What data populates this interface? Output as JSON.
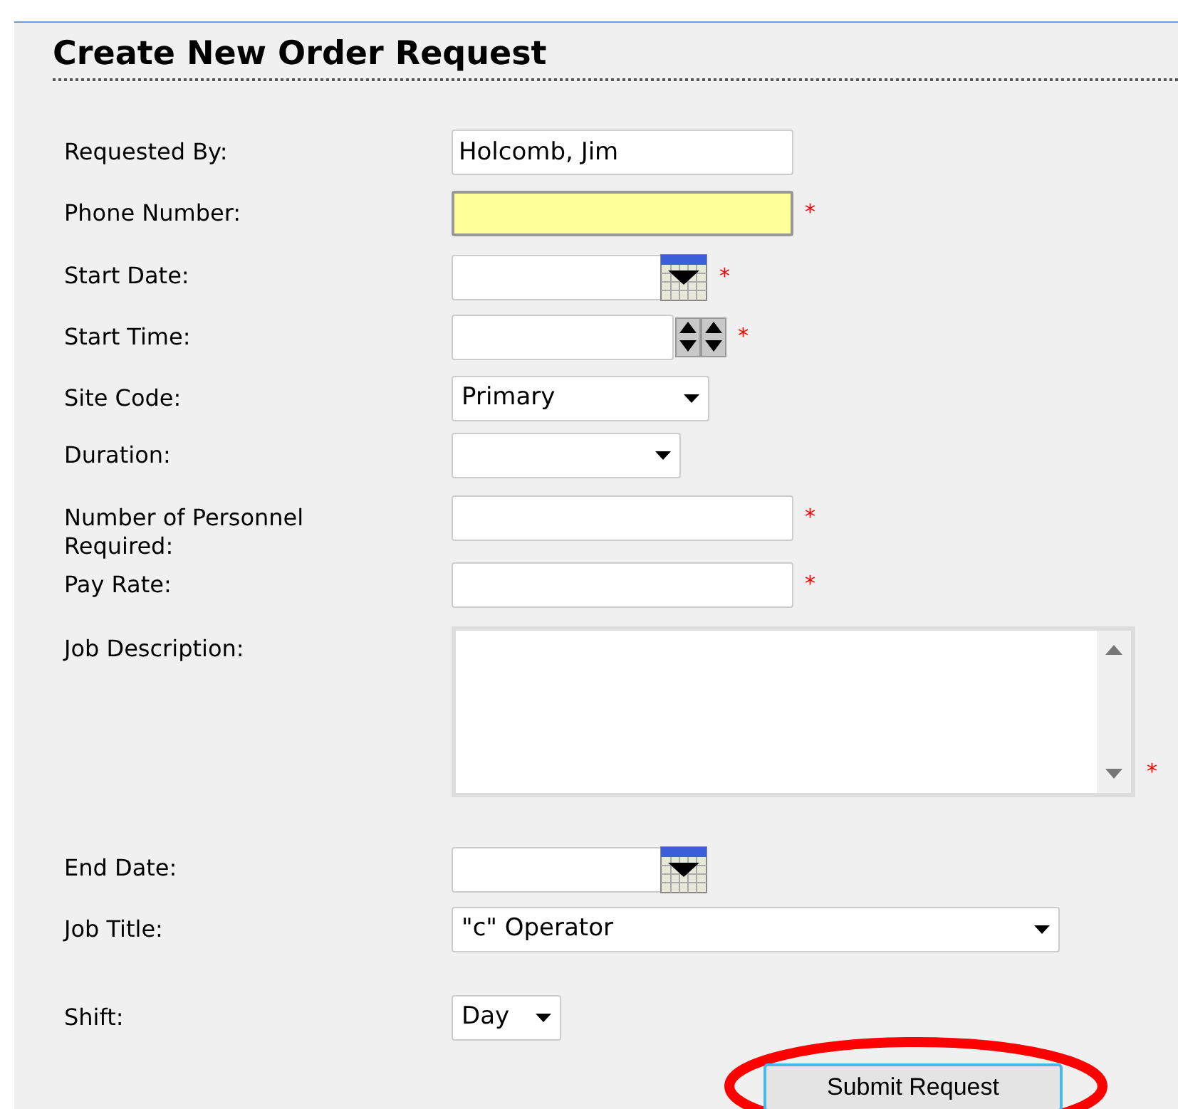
{
  "title": "Create New Order Request",
  "fields": [
    {
      "label": "Requested By:",
      "kind": "text",
      "value": "Holcomb, Jim",
      "highlighted": false
    },
    {
      "label": "Phone Number:",
      "kind": "text",
      "highlighted": true,
      "required_mark": "*"
    },
    {
      "label": "Start Date:",
      "kind": "date",
      "highlighted": false,
      "required_mark": "*"
    },
    {
      "label": "Start Time:",
      "kind": "time",
      "highlighted": false,
      "required_mark": "*"
    },
    {
      "label": "Site Code:",
      "kind": "select",
      "value": "Primary",
      "highlighted": false
    },
    {
      "label": "Duration:",
      "kind": "select",
      "highlighted": false
    },
    {
      "label": "Number of Personnel Required:",
      "kind": "text",
      "highlighted": false,
      "required_mark": "*"
    },
    {
      "label": "Pay Rate:",
      "kind": "text",
      "highlighted": false,
      "required_mark": "*"
    },
    {
      "label": "Job Description:",
      "kind": "textarea",
      "highlighted": false,
      "required_mark": "*"
    },
    {
      "label": "End Date:",
      "kind": "date",
      "highlighted": false
    },
    {
      "label": "Job Title:",
      "kind": "select",
      "value": "\"c\" Operator",
      "highlighted": false
    },
    {
      "label": "Shift:",
      "kind": "select",
      "value": "Day",
      "highlighted": false
    }
  ],
  "submit_button": {
    "label": "Submit Request",
    "circled": true
  }
}
